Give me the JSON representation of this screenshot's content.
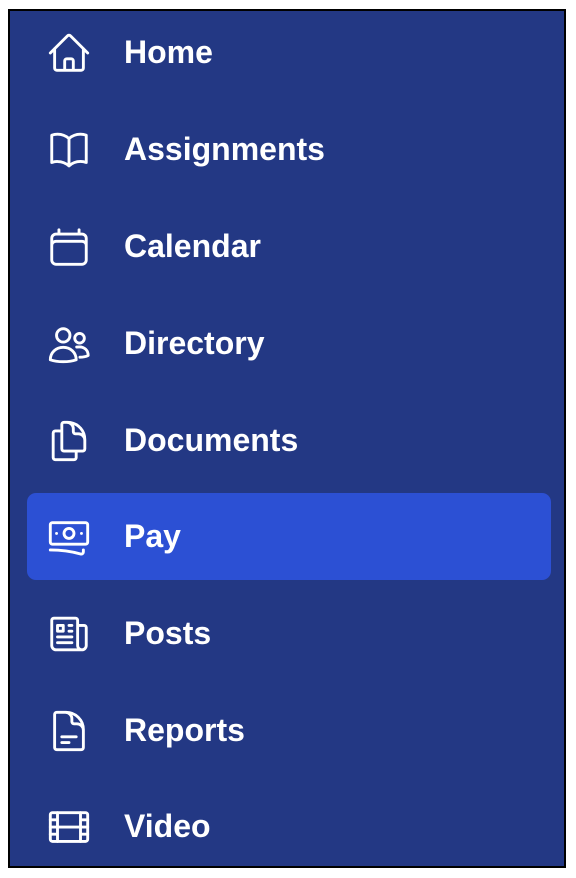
{
  "colors": {
    "sidebar_bg": "#233884",
    "active_bg": "#2c50d4",
    "text": "#ffffff",
    "border": "#000000"
  },
  "nav": {
    "items": [
      {
        "label": "Home",
        "icon": "home-icon",
        "active": false
      },
      {
        "label": "Assignments",
        "icon": "book-icon",
        "active": false
      },
      {
        "label": "Calendar",
        "icon": "calendar-icon",
        "active": false
      },
      {
        "label": "Directory",
        "icon": "users-icon",
        "active": false
      },
      {
        "label": "Documents",
        "icon": "documents-icon",
        "active": false
      },
      {
        "label": "Pay",
        "icon": "money-icon",
        "active": true
      },
      {
        "label": "Posts",
        "icon": "newspaper-icon",
        "active": false
      },
      {
        "label": "Reports",
        "icon": "document-text-icon",
        "active": false
      },
      {
        "label": "Video",
        "icon": "film-icon",
        "active": false
      }
    ]
  }
}
